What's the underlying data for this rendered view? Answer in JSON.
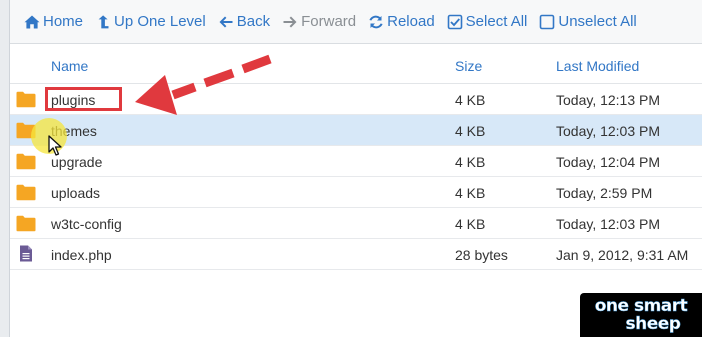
{
  "toolbar": {
    "home": "Home",
    "up_one_level": "Up One Level",
    "back": "Back",
    "forward": "Forward",
    "reload": "Reload",
    "select_all": "Select All",
    "unselect_all": "Unselect All"
  },
  "table": {
    "columns": {
      "name": "Name",
      "size": "Size",
      "last_modified": "Last Modified"
    },
    "rows": [
      {
        "name": "plugins",
        "size": "4 KB",
        "modified": "Today, 12:13 PM",
        "icon": "folder-icon"
      },
      {
        "name": "themes",
        "size": "4 KB",
        "modified": "Today, 12:03 PM",
        "icon": "folder-icon"
      },
      {
        "name": "upgrade",
        "size": "4 KB",
        "modified": "Today, 12:04 PM",
        "icon": "folder-icon"
      },
      {
        "name": "uploads",
        "size": "4 KB",
        "modified": "Today, 2:59 PM",
        "icon": "folder-icon"
      },
      {
        "name": "w3tc-config",
        "size": "4 KB",
        "modified": "Today, 12:03 PM",
        "icon": "folder-icon"
      },
      {
        "name": "index.php",
        "size": "28 bytes",
        "modified": "Jan 9, 2012, 9:31 AM",
        "icon": "file-icon"
      }
    ]
  },
  "colors": {
    "link_blue": "#3277c6",
    "folder_orange": "#f5a623",
    "file_purple": "#6b5b95",
    "selected_row": "#d7e8f8",
    "annotation_red": "#e0393e"
  },
  "watermark": {
    "line1": "one smart",
    "line2": "sheep"
  }
}
